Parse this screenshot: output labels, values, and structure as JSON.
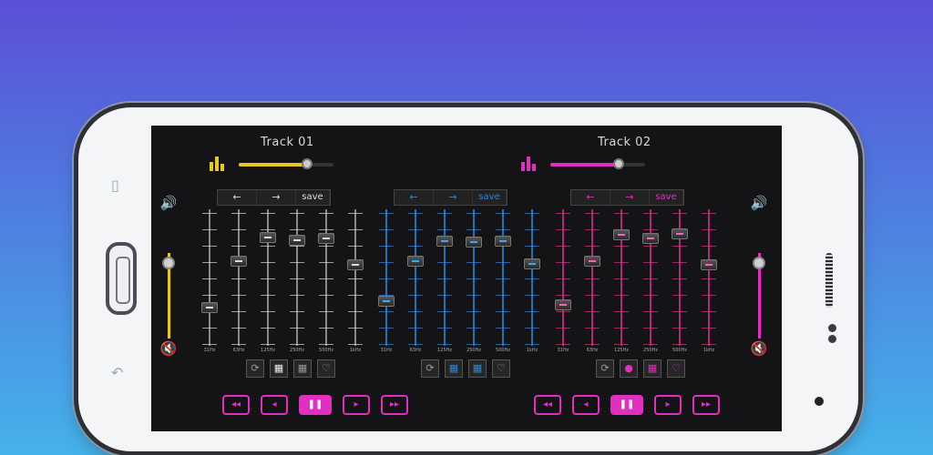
{
  "colors": {
    "yellow": "#e6c91f",
    "blue": "#2f86d8",
    "pink": "#d3318e",
    "magenta": "#e12fbf"
  },
  "deck_left": {
    "title": "Track 01",
    "level": 0.72,
    "nav": {
      "prev": "←",
      "next": "→",
      "save": "save"
    }
  },
  "deck_right": {
    "title": "Track 02",
    "level": 0.72
  },
  "eq_groups": [
    {
      "nav": {
        "prev": "←",
        "next": "→",
        "save": "save"
      }
    },
    {
      "nav": {
        "prev": "←",
        "next": "→",
        "save": "save"
      }
    },
    {
      "nav": {
        "prev": "←",
        "next": "→",
        "save": "save"
      }
    }
  ],
  "frequencies": [
    "31Hz",
    "63Hz",
    "125Hz",
    "250Hz",
    "500Hz",
    "1kHz"
  ],
  "eq_levels": [
    [
      0.26,
      0.63,
      0.82,
      0.8,
      0.81,
      0.6
    ],
    [
      0.31,
      0.63,
      0.79,
      0.78,
      0.79,
      0.61
    ],
    [
      0.28,
      0.63,
      0.84,
      0.81,
      0.85,
      0.6
    ]
  ],
  "volume": {
    "left": 0.95,
    "right": 0.95,
    "speaker": "🔊",
    "mute": "🔇"
  },
  "tools": {
    "repeat": "⟳",
    "grid": "▦",
    "fav": "♡"
  },
  "transport_left": {
    "rew": "◂◂",
    "prev": "◂",
    "play": "❚❚",
    "next": "▸",
    "ff": "▸▸"
  },
  "transport_right": {
    "rew": "◂◂",
    "prev": "◂",
    "play": "❚❚",
    "next": "▸",
    "ff": "▸▸"
  }
}
